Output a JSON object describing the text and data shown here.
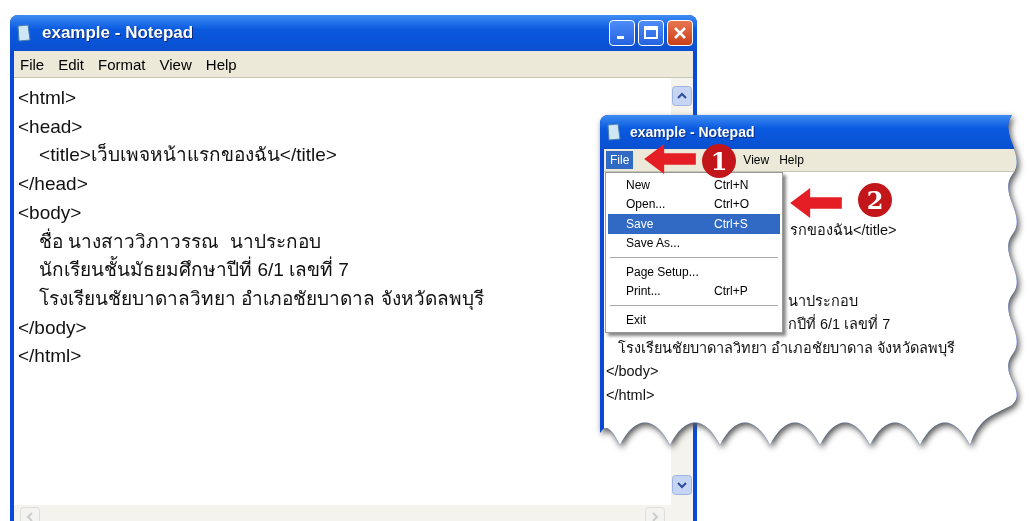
{
  "main_window": {
    "title": "example - Notepad",
    "menu": [
      {
        "label": "File"
      },
      {
        "label": "Edit"
      },
      {
        "label": "Format"
      },
      {
        "label": "View"
      },
      {
        "label": "Help"
      }
    ],
    "lines": [
      "<html>",
      "<head>",
      "    <title>เว็บเพจหน้าแรกของฉัน</title>",
      "</head>",
      "<body>",
      "    ชื่อ นางสาววิภาวรรณ  นาประกอบ",
      "    นักเรียนชั้นมัธยมศึกษาปีที่ 6/1 เลขที่ 7",
      "    โรงเรียนชัยบาดาลวิทยา อำเภอชัยบาดาล จังหวัดลพบุรี",
      "</body>",
      "</html>"
    ]
  },
  "inset_window": {
    "title": "example - Notepad",
    "menu": [
      {
        "label": "File",
        "selected": true
      },
      {
        "label": "View",
        "selected": false
      },
      {
        "label": "Help",
        "selected": false
      }
    ],
    "file_menu": [
      {
        "kind": "item",
        "label": "New",
        "shortcut": "Ctrl+N",
        "selected": false
      },
      {
        "kind": "item",
        "label": "Open...",
        "shortcut": "Ctrl+O",
        "selected": false
      },
      {
        "kind": "item",
        "label": "Save",
        "shortcut": "Ctrl+S",
        "selected": true
      },
      {
        "kind": "item",
        "label": "Save As...",
        "selected": false
      },
      {
        "kind": "separator"
      },
      {
        "kind": "item",
        "label": "Page Setup...",
        "selected": false
      },
      {
        "kind": "item",
        "label": "Print...",
        "shortcut": "Ctrl+P",
        "selected": false
      },
      {
        "kind": "separator"
      },
      {
        "kind": "item",
        "label": "Exit",
        "selected": false
      }
    ],
    "lines": [
      "รกของฉัน</title>",
      "นาประกอบ",
      "กปีที่ 6/1 เลขที่ 7",
      "   โรงเรียนชัยบาดาลวิทยา อำเภอชัยบาดาล จังหวัดลพบุรี",
      "</body>",
      "</html>"
    ]
  },
  "callouts": [
    {
      "number": "1"
    },
    {
      "number": "2"
    }
  ]
}
